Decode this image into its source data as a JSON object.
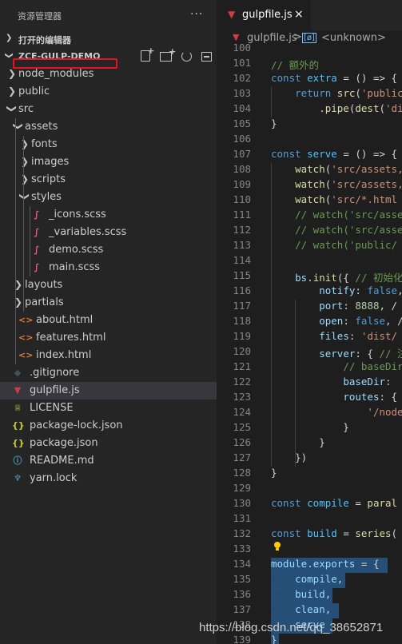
{
  "explorer": {
    "title": "资源管理器",
    "more": "···",
    "open_editors": "打开的编辑器",
    "project": "ZCE-GULP-DEMO"
  },
  "tree": [
    {
      "name": "node_modules",
      "kind": "folder",
      "expanded": false,
      "depth": 0
    },
    {
      "name": "public",
      "kind": "folder",
      "expanded": false,
      "depth": 0
    },
    {
      "name": "src",
      "kind": "folder",
      "expanded": true,
      "depth": 0
    },
    {
      "name": "assets",
      "kind": "folder",
      "expanded": true,
      "depth": 1
    },
    {
      "name": "fonts",
      "kind": "folder",
      "expanded": false,
      "depth": 2
    },
    {
      "name": "images",
      "kind": "folder",
      "expanded": false,
      "depth": 2
    },
    {
      "name": "scripts",
      "kind": "folder",
      "expanded": false,
      "depth": 2
    },
    {
      "name": "styles",
      "kind": "folder",
      "expanded": true,
      "depth": 2
    },
    {
      "name": "_icons.scss",
      "kind": "file",
      "icon": "sass",
      "depth": 3
    },
    {
      "name": "_variables.scss",
      "kind": "file",
      "icon": "sass",
      "depth": 3
    },
    {
      "name": "demo.scss",
      "kind": "file",
      "icon": "sass",
      "depth": 3
    },
    {
      "name": "main.scss",
      "kind": "file",
      "icon": "sass",
      "depth": 3
    },
    {
      "name": "layouts",
      "kind": "folder",
      "expanded": false,
      "depth": 1
    },
    {
      "name": "partials",
      "kind": "folder",
      "expanded": false,
      "depth": 1
    },
    {
      "name": "about.html",
      "kind": "file",
      "icon": "html",
      "depth": 1
    },
    {
      "name": "features.html",
      "kind": "file",
      "icon": "html",
      "depth": 1
    },
    {
      "name": "index.html",
      "kind": "file",
      "icon": "html",
      "depth": 1
    },
    {
      "name": ".gitignore",
      "kind": "file",
      "icon": "git",
      "depth": 0
    },
    {
      "name": "gulpfile.js",
      "kind": "file",
      "icon": "gulp",
      "depth": 0,
      "selected": true
    },
    {
      "name": "LICENSE",
      "kind": "file",
      "icon": "license",
      "depth": 0
    },
    {
      "name": "package-lock.json",
      "kind": "file",
      "icon": "json",
      "depth": 0
    },
    {
      "name": "package.json",
      "kind": "file",
      "icon": "json",
      "depth": 0
    },
    {
      "name": "README.md",
      "kind": "file",
      "icon": "info",
      "depth": 0
    },
    {
      "name": "yarn.lock",
      "kind": "file",
      "icon": "yarn",
      "depth": 0
    }
  ],
  "icons": {
    "sass": "sass-icon",
    "html": "html-icon",
    "git": "git-icon",
    "gulp": "gulp-icon",
    "license": "license-icon",
    "json": "json-icon",
    "info": "info-icon",
    "yarn": "yarn-icon"
  },
  "editor": {
    "tab": {
      "label": "gulpfile.js",
      "close": "×"
    },
    "breadcrumb": {
      "file": "gulpfile.js",
      "separator": ">",
      "symbol_badge": "[ø]",
      "symbol": "<unknown>"
    },
    "lines": [
      {
        "n": "100",
        "t": []
      },
      {
        "n": "101",
        "t": [
          [
            "cm",
            "// 额外的"
          ]
        ]
      },
      {
        "n": "102",
        "t": [
          [
            "kw",
            "const "
          ],
          [
            "con",
            "extra"
          ],
          [
            "pn",
            " = () => {"
          ]
        ]
      },
      {
        "n": "103",
        "t": [
          [
            "pn",
            "    "
          ],
          [
            "kw",
            "return "
          ],
          [
            "fn",
            "src"
          ],
          [
            "pn",
            "("
          ],
          [
            "str",
            "'public"
          ]
        ]
      },
      {
        "n": "104",
        "t": [
          [
            "pn",
            "        ."
          ],
          [
            "fn",
            "pipe"
          ],
          [
            "pn",
            "("
          ],
          [
            "fn",
            "dest"
          ],
          [
            "pn",
            "("
          ],
          [
            "str",
            "'di"
          ]
        ]
      },
      {
        "n": "105",
        "t": [
          [
            "pn",
            "}"
          ]
        ]
      },
      {
        "n": "106",
        "t": []
      },
      {
        "n": "107",
        "t": [
          [
            "kw",
            "const "
          ],
          [
            "con",
            "serve"
          ],
          [
            "pn",
            " = () => {"
          ]
        ]
      },
      {
        "n": "108",
        "t": [
          [
            "pn",
            "    "
          ],
          [
            "fn",
            "watch"
          ],
          [
            "pn",
            "("
          ],
          [
            "str",
            "'src/assets,"
          ]
        ]
      },
      {
        "n": "109",
        "t": [
          [
            "pn",
            "    "
          ],
          [
            "fn",
            "watch"
          ],
          [
            "pn",
            "("
          ],
          [
            "str",
            "'src/assets,"
          ]
        ]
      },
      {
        "n": "110",
        "t": [
          [
            "pn",
            "    "
          ],
          [
            "fn",
            "watch"
          ],
          [
            "pn",
            "("
          ],
          [
            "str",
            "'src/*.html"
          ]
        ]
      },
      {
        "n": "111",
        "t": [
          [
            "pn",
            "    "
          ],
          [
            "cm",
            "// watch('src/asse"
          ]
        ]
      },
      {
        "n": "112",
        "t": [
          [
            "pn",
            "    "
          ],
          [
            "cm",
            "// watch('src/asse"
          ]
        ]
      },
      {
        "n": "113",
        "t": [
          [
            "pn",
            "    "
          ],
          [
            "cm",
            "// watch('public/"
          ]
        ]
      },
      {
        "n": "114",
        "t": []
      },
      {
        "n": "115",
        "t": [
          [
            "pn",
            "    "
          ],
          [
            "var",
            "bs"
          ],
          [
            "pn",
            "."
          ],
          [
            "fn",
            "init"
          ],
          [
            "pn",
            "({ "
          ],
          [
            "cm",
            "// 初始化"
          ]
        ]
      },
      {
        "n": "116",
        "t": [
          [
            "pn",
            "        "
          ],
          [
            "var",
            "notify"
          ],
          [
            "pn",
            ": "
          ],
          [
            "kw",
            "false"
          ],
          [
            "pn",
            ","
          ]
        ]
      },
      {
        "n": "117",
        "t": [
          [
            "pn",
            "        "
          ],
          [
            "var",
            "port"
          ],
          [
            "pn",
            ": "
          ],
          [
            "num",
            "8888"
          ],
          [
            "pn",
            ", /"
          ]
        ]
      },
      {
        "n": "118",
        "t": [
          [
            "pn",
            "        "
          ],
          [
            "var",
            "open"
          ],
          [
            "pn",
            ": "
          ],
          [
            "kw",
            "false"
          ],
          [
            "pn",
            ", /"
          ]
        ]
      },
      {
        "n": "119",
        "t": [
          [
            "pn",
            "        "
          ],
          [
            "var",
            "files"
          ],
          [
            "pn",
            ": "
          ],
          [
            "str",
            "'dist/"
          ]
        ]
      },
      {
        "n": "120",
        "t": [
          [
            "pn",
            "        "
          ],
          [
            "var",
            "server"
          ],
          [
            "pn",
            ": { "
          ],
          [
            "cm",
            "// 注"
          ]
        ]
      },
      {
        "n": "121",
        "t": [
          [
            "pn",
            "            "
          ],
          [
            "cm",
            "// baseDir"
          ]
        ]
      },
      {
        "n": "122",
        "t": [
          [
            "pn",
            "            "
          ],
          [
            "var",
            "baseDir"
          ],
          [
            "pn",
            ":"
          ]
        ]
      },
      {
        "n": "123",
        "t": [
          [
            "pn",
            "            "
          ],
          [
            "var",
            "routes"
          ],
          [
            "pn",
            ": {"
          ]
        ]
      },
      {
        "n": "124",
        "t": [
          [
            "pn",
            "                "
          ],
          [
            "str",
            "'/node"
          ]
        ]
      },
      {
        "n": "125",
        "t": [
          [
            "pn",
            "            }"
          ]
        ]
      },
      {
        "n": "126",
        "t": [
          [
            "pn",
            "        }"
          ]
        ]
      },
      {
        "n": "127",
        "t": [
          [
            "pn",
            "    })"
          ]
        ]
      },
      {
        "n": "128",
        "t": [
          [
            "pn",
            "}"
          ]
        ]
      },
      {
        "n": "129",
        "t": []
      },
      {
        "n": "130",
        "t": [
          [
            "kw",
            "const "
          ],
          [
            "con",
            "compile"
          ],
          [
            "pn",
            " = "
          ],
          [
            "fn",
            "paral"
          ]
        ]
      },
      {
        "n": "131",
        "t": []
      },
      {
        "n": "132",
        "t": [
          [
            "kw",
            "const "
          ],
          [
            "con",
            "build"
          ],
          [
            "pn",
            " = "
          ],
          [
            "fn",
            "series"
          ],
          [
            "pn",
            "("
          ]
        ]
      },
      {
        "n": "133",
        "t": []
      },
      {
        "n": "134",
        "t": [
          [
            "var",
            "module"
          ],
          [
            "pn",
            "."
          ],
          [
            "var",
            "exports"
          ],
          [
            "pn",
            " = {"
          ]
        ]
      },
      {
        "n": "135",
        "t": [
          [
            "ws",
            "····"
          ],
          [
            "var",
            "compile"
          ],
          [
            "pn",
            ","
          ]
        ]
      },
      {
        "n": "136",
        "t": [
          [
            "ws",
            "····"
          ],
          [
            "var",
            "build"
          ],
          [
            "pn",
            ","
          ]
        ]
      },
      {
        "n": "137",
        "t": [
          [
            "ws",
            "····"
          ],
          [
            "var",
            "clean"
          ],
          [
            "pn",
            ","
          ]
        ]
      },
      {
        "n": "138",
        "t": [
          [
            "ws",
            "····"
          ],
          [
            "var",
            "serve"
          ]
        ]
      },
      {
        "n": "139",
        "t": [
          [
            "pn",
            "}"
          ]
        ]
      }
    ]
  },
  "watermark": "https://blog.csdn.net/qq_38652871",
  "colors": {
    "annotation_box": "#e81123",
    "selection": "#264f78",
    "sidebar": "#252526",
    "editor": "#1e1e1e"
  }
}
